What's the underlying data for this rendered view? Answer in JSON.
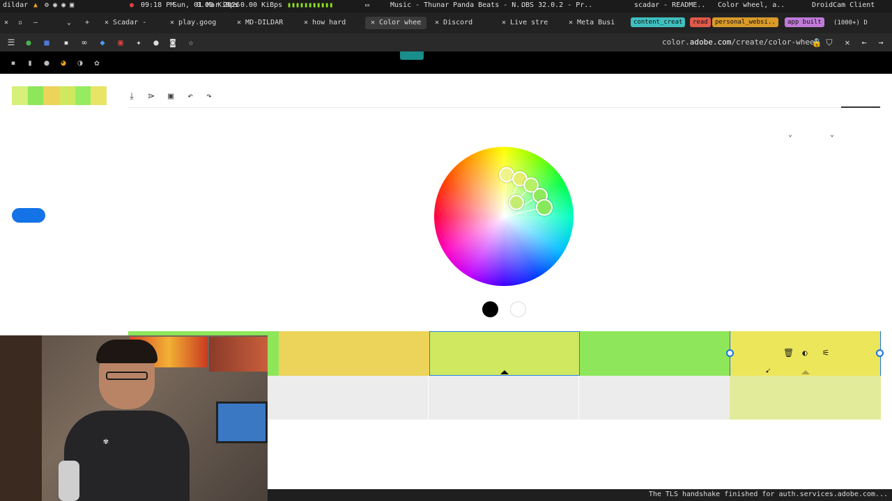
{
  "taskbar": {
    "left_user": "dildar",
    "clock_time": "09:18 PM",
    "clock_date": "Sun, 01 Mar 2026",
    "net_down": "0.00 KiBps",
    "net_up": "0.00 KiBps",
    "app_thunar": "Music - Thunar",
    "app_panda": "Panda Beats - N..",
    "app_obs": "OBS 32.0.2 - Pr..",
    "app_readme": "scadar - README..",
    "app_colorwheel": "Color wheel, a..",
    "app_droidcam": "DroidCam Client"
  },
  "tabs": {
    "items": [
      {
        "label": "Scadar - ",
        "active": false
      },
      {
        "label": "play.goog",
        "active": false
      },
      {
        "label": "MD-DILDAR",
        "active": false
      },
      {
        "label": "how hard",
        "active": false
      },
      {
        "label": "Color whee",
        "active": true
      },
      {
        "label": "Discord",
        "active": false
      },
      {
        "label": "Live stre",
        "active": false
      },
      {
        "label": "Meta Busi",
        "active": false
      }
    ],
    "pills": [
      {
        "label": "content_creat",
        "color": "#3fbfbf"
      },
      {
        "label": "read",
        "color": "#e05a4a"
      },
      {
        "label": "personal_websi..",
        "color": "#d99a2a"
      },
      {
        "label": "app built",
        "color": "#c07ad9"
      },
      {
        "label": "(1000+) D",
        "color": ""
      }
    ]
  },
  "navbar": {
    "url_prefix": "color.",
    "url_domain": "adobe.com",
    "url_path": "/create/color-wheel"
  },
  "palette": {
    "mini": [
      "#d6f07a",
      "#8ee65a",
      "#ecd35a",
      "#cfe85f",
      "#96ec60",
      "#e8e466"
    ],
    "strip_top": [
      "#8ee65a",
      "#ecd35a",
      "#cfe85f",
      "#8ee65a",
      "#ece65a"
    ],
    "strip_bottom": [
      "#ececec",
      "#ececec",
      "#ececec",
      "#e2eb9a"
    ]
  },
  "colors": {
    "accent_blue": "#1473e6",
    "teal_tab": "#1a8d8d"
  },
  "status": {
    "message": "The TLS handshake finished for auth.services.adobe.com..."
  }
}
